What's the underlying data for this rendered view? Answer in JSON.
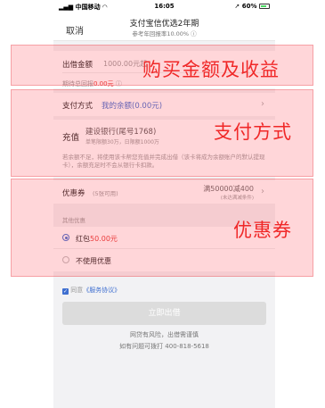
{
  "status_bar": {
    "carrier": "中国移动",
    "time": "16:05",
    "battery": "60%"
  },
  "nav": {
    "cancel": "取消",
    "title": "支付宝信优选2年期",
    "subtitle": "参考年回报率10.00%"
  },
  "amount": {
    "label": "出借金额",
    "placeholder": "1000.00元起",
    "expected_label": "期待总回报",
    "expected_value": "0.00元"
  },
  "payment": {
    "label": "支付方式",
    "value": "我的余额(0.00元)",
    "recharge_label": "充值",
    "bank_name": "建设银行(尾号1768)",
    "bank_limit": "单笔限额30万，日限额1000万",
    "notice": "若余额不足，将使用该卡帮您充值并完成出借（该卡将成为余额账户的默认提现卡），余额充足时不会从银行卡扣款。"
  },
  "coupon": {
    "label": "优惠券",
    "count": "(5张可用)",
    "value": "满50000减400",
    "value_sub": "(未达满减条件)",
    "other_label": "其他优惠",
    "options": [
      {
        "prefix": "红包",
        "amount": "50.00元",
        "selected": true
      },
      {
        "label": "不使用优惠",
        "selected": false
      }
    ]
  },
  "agree": {
    "prefix": "同意",
    "link": "《服务协议》"
  },
  "submit": {
    "label": "立即出借"
  },
  "footer": {
    "risk": "网贷有风险，出借需谨慎",
    "hotline": "如有问题可拨打 400-818-5618"
  },
  "annotations": {
    "purchase": "购买金额及收益",
    "payment": "支付方式",
    "coupon": "优惠券"
  },
  "colors": {
    "accent": "#3f6fd0",
    "annotation": "#f02828",
    "overlay": "rgba(255,70,80,0.22)"
  }
}
